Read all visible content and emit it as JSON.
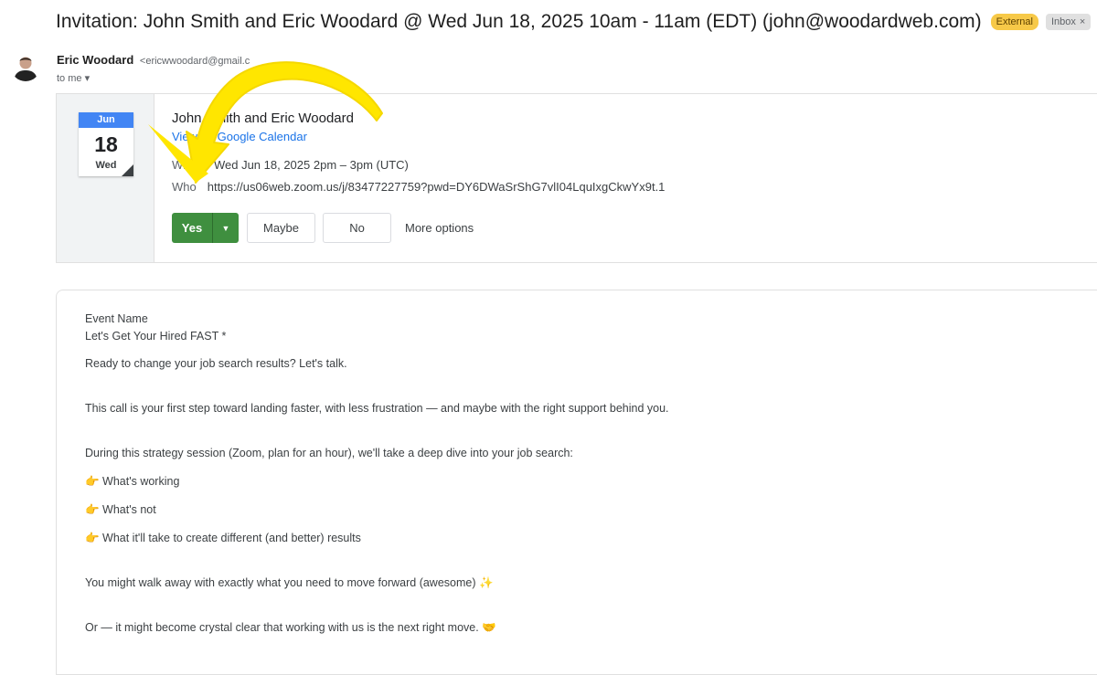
{
  "header": {
    "subject": "Invitation: John Smith and Eric Woodard @ Wed Jun 18, 2025 10am - 11am (EDT) (john@woodardweb.com)",
    "tag_external": "External",
    "tag_inbox": "Inbox",
    "tag_close": "×"
  },
  "sender": {
    "name": "Eric Woodard",
    "email": "<ericwwoodard@gmail.c",
    "to_me": "to me ▾"
  },
  "invite": {
    "cal_month": "Jun",
    "cal_day": "18",
    "cal_dow": "Wed",
    "title": "John Smith and Eric Woodard",
    "calendar_link": "View on Google Calendar",
    "when_label": "When",
    "when_value": "Wed Jun 18, 2025 2pm – 3pm (UTC)",
    "join_label": "Who",
    "join_url": "https://us06web.zoom.us/j/83477227759?pwd=DY6DWaSrShG7vlI04LquIxgCkwYx9t.1",
    "yes_label": "Yes",
    "maybe_label": "Maybe",
    "no_label": "No",
    "more_options_label": "More options"
  },
  "body": {
    "lines": [
      "Event Name",
      "Let's Get Your Hired FAST *",
      "Ready to change your job search results? Let's talk.",
      "This call is your first step toward landing faster, with less frustration — and maybe with the right support behind you.",
      "During this strategy session (Zoom, plan for an hour), we'll take a deep dive into your job search:",
      "👉 What's working",
      "👉 What's not",
      "👉 What it'll take to create different (and better) results",
      "You might walk away with exactly what you need to move forward (awesome) ✨",
      "Or — it might become crystal clear that working with us is the next right move. 🤝"
    ]
  },
  "colors": {
    "accent_yes": "#3f8f3f",
    "tag_external": "#f7c948",
    "calendar_blue": "#4285f4",
    "link": "#1a73e8",
    "annotation_arrow": "#ffe600"
  }
}
